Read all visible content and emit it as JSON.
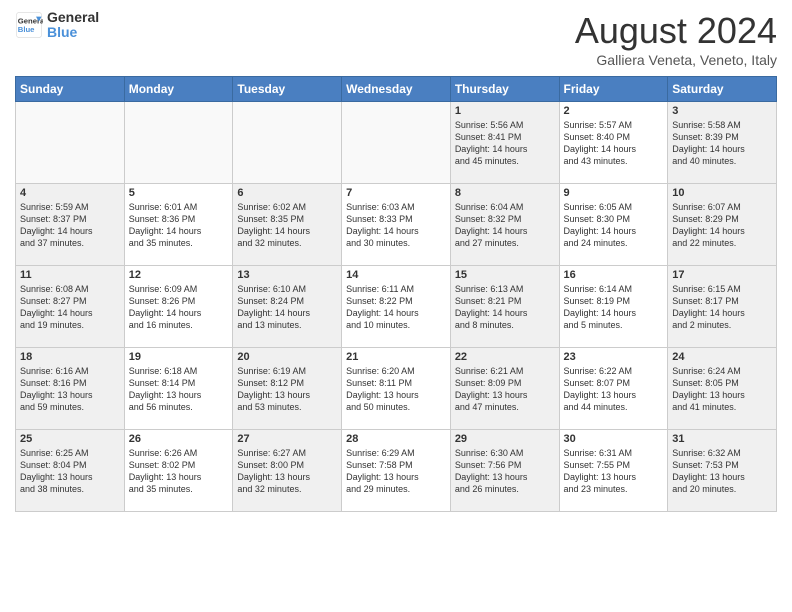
{
  "header": {
    "logo_line1": "General",
    "logo_line2": "Blue",
    "title": "August 2024",
    "subtitle": "Galliera Veneta, Veneto, Italy"
  },
  "days_of_week": [
    "Sunday",
    "Monday",
    "Tuesday",
    "Wednesday",
    "Thursday",
    "Friday",
    "Saturday"
  ],
  "weeks": [
    [
      {
        "num": "",
        "info": "",
        "empty": true
      },
      {
        "num": "",
        "info": "",
        "empty": true
      },
      {
        "num": "",
        "info": "",
        "empty": true
      },
      {
        "num": "",
        "info": "",
        "empty": true
      },
      {
        "num": "1",
        "info": "Sunrise: 5:56 AM\nSunset: 8:41 PM\nDaylight: 14 hours\nand 45 minutes.",
        "shaded": true
      },
      {
        "num": "2",
        "info": "Sunrise: 5:57 AM\nSunset: 8:40 PM\nDaylight: 14 hours\nand 43 minutes."
      },
      {
        "num": "3",
        "info": "Sunrise: 5:58 AM\nSunset: 8:39 PM\nDaylight: 14 hours\nand 40 minutes.",
        "shaded": true
      }
    ],
    [
      {
        "num": "4",
        "info": "Sunrise: 5:59 AM\nSunset: 8:37 PM\nDaylight: 14 hours\nand 37 minutes.",
        "shaded": true
      },
      {
        "num": "5",
        "info": "Sunrise: 6:01 AM\nSunset: 8:36 PM\nDaylight: 14 hours\nand 35 minutes."
      },
      {
        "num": "6",
        "info": "Sunrise: 6:02 AM\nSunset: 8:35 PM\nDaylight: 14 hours\nand 32 minutes.",
        "shaded": true
      },
      {
        "num": "7",
        "info": "Sunrise: 6:03 AM\nSunset: 8:33 PM\nDaylight: 14 hours\nand 30 minutes."
      },
      {
        "num": "8",
        "info": "Sunrise: 6:04 AM\nSunset: 8:32 PM\nDaylight: 14 hours\nand 27 minutes.",
        "shaded": true
      },
      {
        "num": "9",
        "info": "Sunrise: 6:05 AM\nSunset: 8:30 PM\nDaylight: 14 hours\nand 24 minutes."
      },
      {
        "num": "10",
        "info": "Sunrise: 6:07 AM\nSunset: 8:29 PM\nDaylight: 14 hours\nand 22 minutes.",
        "shaded": true
      }
    ],
    [
      {
        "num": "11",
        "info": "Sunrise: 6:08 AM\nSunset: 8:27 PM\nDaylight: 14 hours\nand 19 minutes.",
        "shaded": true
      },
      {
        "num": "12",
        "info": "Sunrise: 6:09 AM\nSunset: 8:26 PM\nDaylight: 14 hours\nand 16 minutes."
      },
      {
        "num": "13",
        "info": "Sunrise: 6:10 AM\nSunset: 8:24 PM\nDaylight: 14 hours\nand 13 minutes.",
        "shaded": true
      },
      {
        "num": "14",
        "info": "Sunrise: 6:11 AM\nSunset: 8:22 PM\nDaylight: 14 hours\nand 10 minutes."
      },
      {
        "num": "15",
        "info": "Sunrise: 6:13 AM\nSunset: 8:21 PM\nDaylight: 14 hours\nand 8 minutes.",
        "shaded": true
      },
      {
        "num": "16",
        "info": "Sunrise: 6:14 AM\nSunset: 8:19 PM\nDaylight: 14 hours\nand 5 minutes."
      },
      {
        "num": "17",
        "info": "Sunrise: 6:15 AM\nSunset: 8:17 PM\nDaylight: 14 hours\nand 2 minutes.",
        "shaded": true
      }
    ],
    [
      {
        "num": "18",
        "info": "Sunrise: 6:16 AM\nSunset: 8:16 PM\nDaylight: 13 hours\nand 59 minutes.",
        "shaded": true
      },
      {
        "num": "19",
        "info": "Sunrise: 6:18 AM\nSunset: 8:14 PM\nDaylight: 13 hours\nand 56 minutes."
      },
      {
        "num": "20",
        "info": "Sunrise: 6:19 AM\nSunset: 8:12 PM\nDaylight: 13 hours\nand 53 minutes.",
        "shaded": true
      },
      {
        "num": "21",
        "info": "Sunrise: 6:20 AM\nSunset: 8:11 PM\nDaylight: 13 hours\nand 50 minutes."
      },
      {
        "num": "22",
        "info": "Sunrise: 6:21 AM\nSunset: 8:09 PM\nDaylight: 13 hours\nand 47 minutes.",
        "shaded": true
      },
      {
        "num": "23",
        "info": "Sunrise: 6:22 AM\nSunset: 8:07 PM\nDaylight: 13 hours\nand 44 minutes."
      },
      {
        "num": "24",
        "info": "Sunrise: 6:24 AM\nSunset: 8:05 PM\nDaylight: 13 hours\nand 41 minutes.",
        "shaded": true
      }
    ],
    [
      {
        "num": "25",
        "info": "Sunrise: 6:25 AM\nSunset: 8:04 PM\nDaylight: 13 hours\nand 38 minutes.",
        "shaded": true
      },
      {
        "num": "26",
        "info": "Sunrise: 6:26 AM\nSunset: 8:02 PM\nDaylight: 13 hours\nand 35 minutes."
      },
      {
        "num": "27",
        "info": "Sunrise: 6:27 AM\nSunset: 8:00 PM\nDaylight: 13 hours\nand 32 minutes.",
        "shaded": true
      },
      {
        "num": "28",
        "info": "Sunrise: 6:29 AM\nSunset: 7:58 PM\nDaylight: 13 hours\nand 29 minutes."
      },
      {
        "num": "29",
        "info": "Sunrise: 6:30 AM\nSunset: 7:56 PM\nDaylight: 13 hours\nand 26 minutes.",
        "shaded": true
      },
      {
        "num": "30",
        "info": "Sunrise: 6:31 AM\nSunset: 7:55 PM\nDaylight: 13 hours\nand 23 minutes."
      },
      {
        "num": "31",
        "info": "Sunrise: 6:32 AM\nSunset: 7:53 PM\nDaylight: 13 hours\nand 20 minutes.",
        "shaded": true
      }
    ]
  ]
}
